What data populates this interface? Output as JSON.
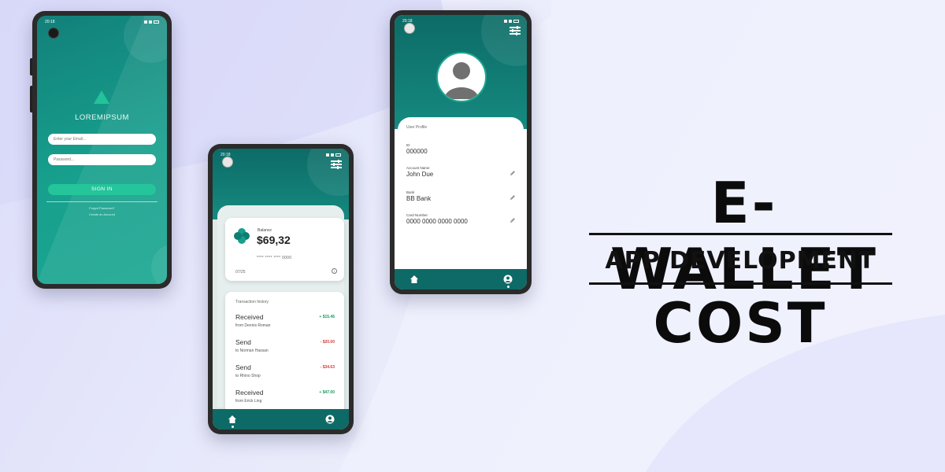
{
  "colors": {
    "teal_dark": "#0e6a66",
    "teal_mid": "#158a80",
    "mint": "#24c59b",
    "positive": "#1a9b5b",
    "negative": "#d83a3a",
    "headline": "#0b0b0b"
  },
  "status_bar": {
    "time": "20:18"
  },
  "login": {
    "brand": "LOREMIPSUM",
    "email_placeholder": "Enter your Email...",
    "password_placeholder": "Password...",
    "signin_label": "SIGN IN",
    "forgot_password": "Forgot Password?",
    "create_account": "Create an Account"
  },
  "wallet": {
    "balance_label": "Balance",
    "balance_value": "$69,32",
    "card_number_masked": "**** **** **** 0000",
    "card_expiry": "07/25",
    "info_glyph": "i",
    "transactions_title": "Transaction history",
    "transactions": [
      {
        "kind": "Received",
        "prefix": "from",
        "counterparty": "Dennis Roman",
        "amount": "+ $15.46",
        "sign": "pos"
      },
      {
        "kind": "Send",
        "prefix": "to",
        "counterparty": "Norman Hassan",
        "amount": "- $20.00",
        "sign": "neg"
      },
      {
        "kind": "Send",
        "prefix": "to",
        "counterparty": "Rhino Shop",
        "amount": "- $34.63",
        "sign": "neg"
      },
      {
        "kind": "Received",
        "prefix": "from",
        "counterparty": "Erick Ling",
        "amount": "+ $47.00",
        "sign": "pos"
      }
    ],
    "nav": [
      "home-icon",
      "user-icon"
    ]
  },
  "profile": {
    "title": "User Profile",
    "fields": [
      {
        "label": "ID",
        "value": "000000",
        "editable": false
      },
      {
        "label": "Account Name",
        "value": "John Due",
        "editable": true
      },
      {
        "label": "Bank",
        "value": "BB Bank",
        "editable": true
      },
      {
        "label": "Card Number",
        "value": "0000 0000 0000 0000",
        "editable": true
      }
    ],
    "nav": [
      "home-icon",
      "user-icon"
    ]
  },
  "headline": {
    "line1": "E-WALLET",
    "line2": "APP DEVELOPMENT",
    "line3": "COST"
  }
}
